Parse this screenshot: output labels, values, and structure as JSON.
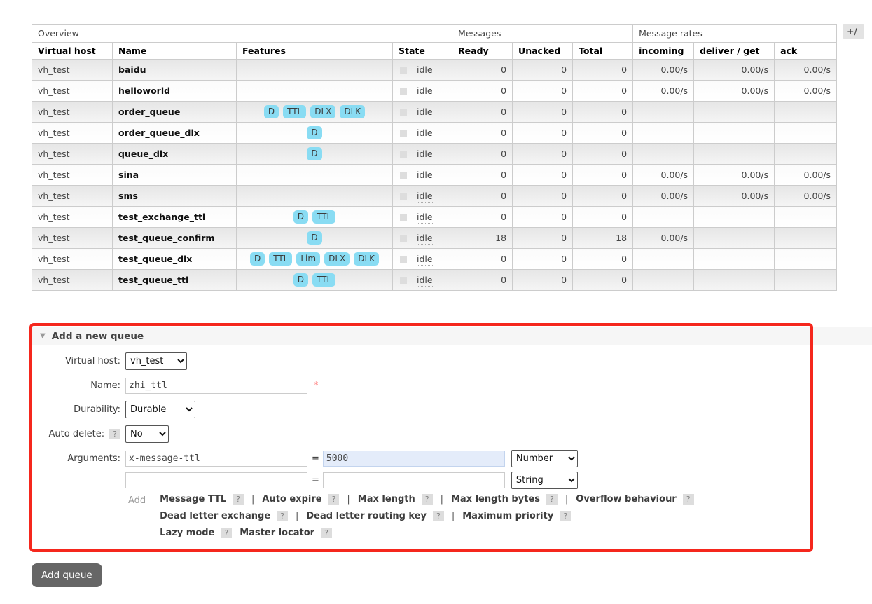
{
  "table": {
    "plus_minus": "+/-",
    "group_headers": [
      {
        "label": "Overview",
        "colspan": 4
      },
      {
        "label": "Messages",
        "colspan": 3
      },
      {
        "label": "Message rates",
        "colspan": 3
      }
    ],
    "columns": [
      "Virtual host",
      "Name",
      "Features",
      "State",
      "Ready",
      "Unacked",
      "Total",
      "incoming",
      "deliver / get",
      "ack"
    ],
    "rows": [
      {
        "vhost": "vh_test",
        "name": "baidu",
        "features": [],
        "state": "idle",
        "ready": "0",
        "unacked": "0",
        "total": "0",
        "incoming": "0.00/s",
        "deliver_get": "0.00/s",
        "ack": "0.00/s"
      },
      {
        "vhost": "vh_test",
        "name": "helloworld",
        "features": [],
        "state": "idle",
        "ready": "0",
        "unacked": "0",
        "total": "0",
        "incoming": "0.00/s",
        "deliver_get": "0.00/s",
        "ack": "0.00/s"
      },
      {
        "vhost": "vh_test",
        "name": "order_queue",
        "features": [
          "D",
          "TTL",
          "DLX",
          "DLK"
        ],
        "state": "idle",
        "ready": "0",
        "unacked": "0",
        "total": "0",
        "incoming": "",
        "deliver_get": "",
        "ack": ""
      },
      {
        "vhost": "vh_test",
        "name": "order_queue_dlx",
        "features": [
          "D"
        ],
        "state": "idle",
        "ready": "0",
        "unacked": "0",
        "total": "0",
        "incoming": "",
        "deliver_get": "",
        "ack": ""
      },
      {
        "vhost": "vh_test",
        "name": "queue_dlx",
        "features": [
          "D"
        ],
        "state": "idle",
        "ready": "0",
        "unacked": "0",
        "total": "0",
        "incoming": "",
        "deliver_get": "",
        "ack": ""
      },
      {
        "vhost": "vh_test",
        "name": "sina",
        "features": [],
        "state": "idle",
        "ready": "0",
        "unacked": "0",
        "total": "0",
        "incoming": "0.00/s",
        "deliver_get": "0.00/s",
        "ack": "0.00/s"
      },
      {
        "vhost": "vh_test",
        "name": "sms",
        "features": [],
        "state": "idle",
        "ready": "0",
        "unacked": "0",
        "total": "0",
        "incoming": "0.00/s",
        "deliver_get": "0.00/s",
        "ack": "0.00/s"
      },
      {
        "vhost": "vh_test",
        "name": "test_exchange_ttl",
        "features": [
          "D",
          "TTL"
        ],
        "state": "idle",
        "ready": "0",
        "unacked": "0",
        "total": "0",
        "incoming": "",
        "deliver_get": "",
        "ack": ""
      },
      {
        "vhost": "vh_test",
        "name": "test_queue_confirm",
        "features": [
          "D"
        ],
        "state": "idle",
        "ready": "18",
        "unacked": "0",
        "total": "18",
        "incoming": "0.00/s",
        "deliver_get": "",
        "ack": ""
      },
      {
        "vhost": "vh_test",
        "name": "test_queue_dlx",
        "features": [
          "D",
          "TTL",
          "Lim",
          "DLX",
          "DLK"
        ],
        "state": "idle",
        "ready": "0",
        "unacked": "0",
        "total": "0",
        "incoming": "",
        "deliver_get": "",
        "ack": ""
      },
      {
        "vhost": "vh_test",
        "name": "test_queue_ttl",
        "features": [
          "D",
          "TTL"
        ],
        "state": "idle",
        "ready": "0",
        "unacked": "0",
        "total": "0",
        "incoming": "",
        "deliver_get": "",
        "ack": ""
      }
    ]
  },
  "form": {
    "section_title": "Add a new queue",
    "fields": {
      "virtual_host": {
        "label": "Virtual host:",
        "value": "vh_test"
      },
      "name": {
        "label": "Name:",
        "value": "zhi_ttl",
        "required_marker": "*"
      },
      "durability": {
        "label": "Durability:",
        "value": "Durable"
      },
      "auto_delete": {
        "label": "Auto delete:",
        "help": "?",
        "value": "No"
      },
      "arguments": {
        "label": "Arguments:",
        "equals": "=",
        "rows": [
          {
            "key": "x-message-ttl",
            "value": "5000",
            "type": "Number"
          },
          {
            "key": "",
            "value": "",
            "type": "String"
          }
        ]
      }
    },
    "add_label": "Add",
    "argument_links": {
      "help_marker": "?",
      "lines": [
        {
          "items": [
            "Message TTL",
            "Auto expire",
            "Max length",
            "Max length bytes",
            "Overflow behaviour"
          ],
          "separator": "|"
        },
        {
          "items": [
            "Dead letter exchange",
            "Dead letter routing key",
            "Maximum priority"
          ],
          "separator": "|"
        },
        {
          "items": [
            "Lazy mode",
            "Master locator"
          ],
          "separator": ""
        }
      ]
    },
    "submit_label": "Add queue"
  },
  "colors": {
    "feature_badge_bg": "#89DCF3",
    "annotation_border": "#F5271D",
    "highlight_input_bg": "#E4ECFA",
    "button_bg": "#666666",
    "help_chip_bg": "#DDDDDD",
    "section_bar_bg": "#F6F6F6",
    "required_marker": "#FF8C8C"
  }
}
